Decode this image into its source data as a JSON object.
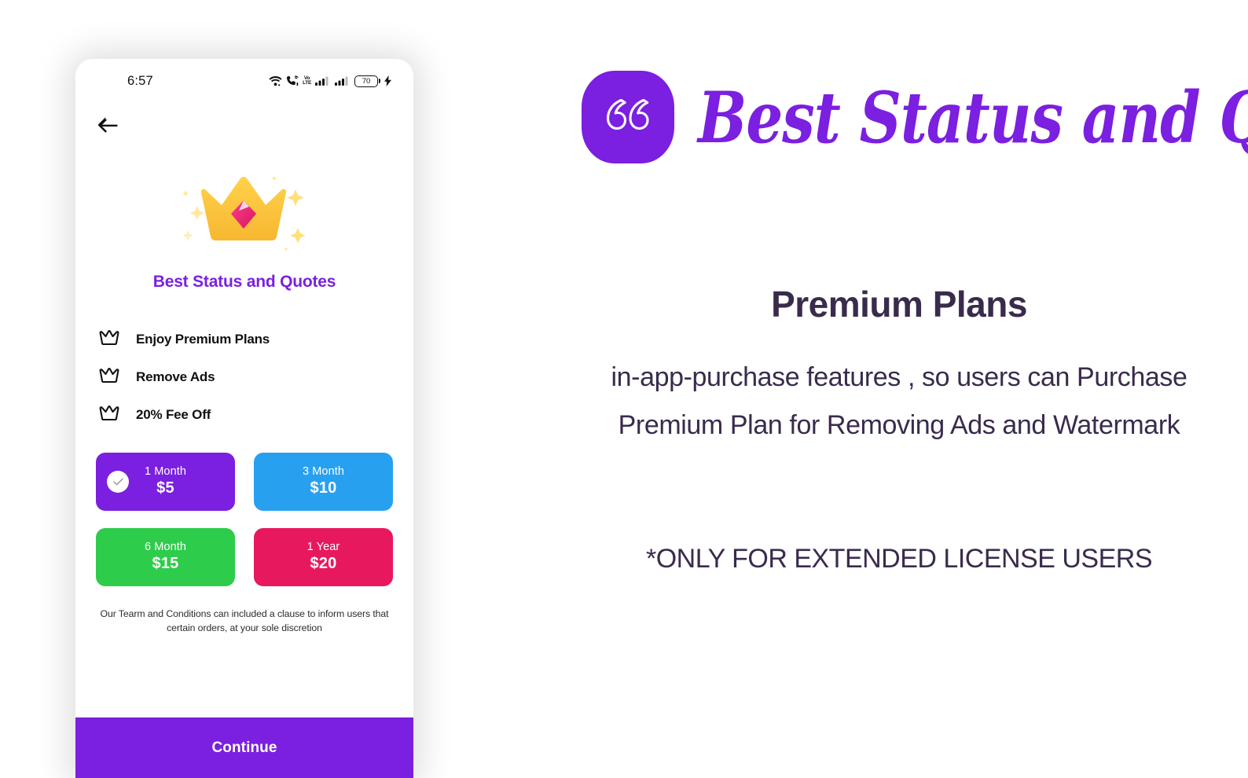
{
  "phone": {
    "status_bar": {
      "time": "6:57",
      "icons": [
        "wifi-icon",
        "call-wifi-icon",
        "volte-icon",
        "signal-bars-sim1-icon",
        "signal-bars-sim2-icon",
        "battery-icon",
        "charging-bolt-icon"
      ],
      "volte_top": "Vo",
      "volte_bottom": "LTE",
      "battery_level": "70"
    },
    "back_button": "back-arrow-icon",
    "hero_icon": "crown-emoji",
    "app_title": "Best Status and Quotes",
    "features": [
      {
        "icon": "crown-outline-icon",
        "label": "Enjoy Premium Plans"
      },
      {
        "icon": "crown-outline-icon",
        "label": "Remove Ads"
      },
      {
        "icon": "crown-outline-icon",
        "label": "20% Fee Off"
      }
    ],
    "plans": [
      {
        "period": "1 Month",
        "price": "$5",
        "color": "#7b1fe0",
        "selected": true
      },
      {
        "period": "3 Month",
        "price": "$10",
        "color": "#28a0f0",
        "selected": false
      },
      {
        "period": "6 Month",
        "price": "$15",
        "color": "#2ecc4b",
        "selected": false
      },
      {
        "period": "1 Year",
        "price": "$20",
        "color": "#e8185e",
        "selected": false
      }
    ],
    "terms": "Our Tearm and Conditions can included a clause to inform users that certain orders, at your sole discretion",
    "continue_label": "Continue"
  },
  "promo": {
    "brand_icon": "quote-marks-icon",
    "brand_name": "Best Status and Quotes",
    "headline": "Premium Plans",
    "subcopy": "in-app-purchase features , so users can Purchase Premium Plan for Removing Ads and Watermark",
    "note": "*ONLY FOR EXTENDED LICENSE USERS"
  },
  "colors": {
    "brand_purple": "#7b1fe0",
    "text_dark": "#3a2b4d"
  }
}
